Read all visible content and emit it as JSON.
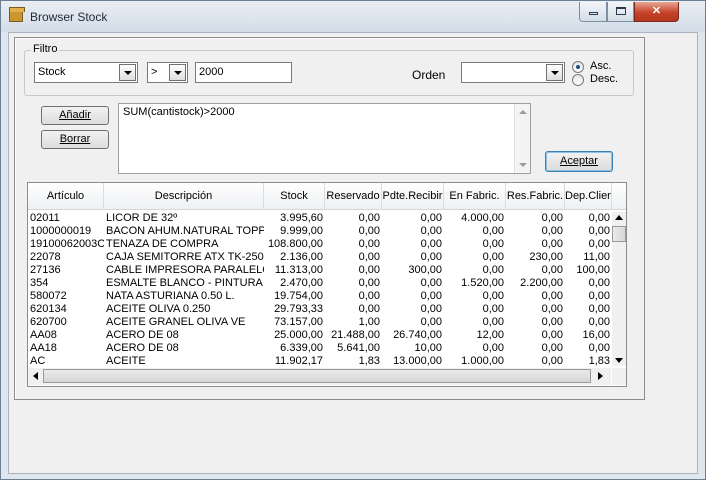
{
  "window": {
    "title": "Browser Stock"
  },
  "filter": {
    "group_label": "Filtro",
    "field_value": "Stock",
    "operator_value": ">",
    "value": "2000",
    "orden_label": "Orden",
    "orden_value": "",
    "asc_label": "Asc.",
    "desc_label": "Desc.",
    "selected_order": "Asc."
  },
  "buttons": {
    "add": "Añadir",
    "delete": "Borrar",
    "accept": "Aceptar"
  },
  "expression": "SUM(cantistock)>2000",
  "table": {
    "columns": [
      "Artículo",
      "Descripción",
      "Stock",
      "Reservado",
      "Pdte.Recibir",
      "En Fabric.",
      "Res.Fabric.",
      "Dep.Clientes"
    ],
    "rows": [
      [
        "02011",
        "LICOR DE 32º",
        "3.995,60",
        "0,00",
        "0,00",
        "4.000,00",
        "0,00",
        "0,00"
      ],
      [
        "1000000019",
        "BACON AHUM.NATURAL TOPP",
        "9.999,00",
        "0,00",
        "0,00",
        "0,00",
        "0,00",
        "0,00"
      ],
      [
        "19100062003C",
        "TENAZA DE COMPRA",
        "108.800,00",
        "0,00",
        "0,00",
        "0,00",
        "0,00",
        "0,00"
      ],
      [
        "22078",
        "CAJA SEMITORRE ATX TK-250",
        "2.136,00",
        "0,00",
        "0,00",
        "0,00",
        "230,00",
        "11,00"
      ],
      [
        "27136",
        "CABLE IMPRESORA PARALELO",
        "11.313,00",
        "0,00",
        "300,00",
        "0,00",
        "0,00",
        "100,00"
      ],
      [
        "354",
        "ESMALTE BLANCO - PINTURA",
        "2.470,00",
        "0,00",
        "0,00",
        "1.520,00",
        "2.200,00",
        "0,00"
      ],
      [
        "580072",
        "NATA ASTURIANA 0.50 L.",
        "19.754,00",
        "0,00",
        "0,00",
        "0,00",
        "0,00",
        "0,00"
      ],
      [
        "620134",
        "ACEITE OLIVA 0.250",
        "29.793,33",
        "0,00",
        "0,00",
        "0,00",
        "0,00",
        "0,00"
      ],
      [
        "620700",
        "ACEITE GRANEL OLIVA VE",
        "73.157,00",
        "1,00",
        "0,00",
        "0,00",
        "0,00",
        "0,00"
      ],
      [
        "AA08",
        "ACERO DE 08",
        "25.000,00",
        "21.488,00",
        "26.740,00",
        "12,00",
        "0,00",
        "16,00"
      ],
      [
        "AA18",
        "ACERO DE 08",
        "6.339,00",
        "5.641,00",
        "10,00",
        "0,00",
        "0,00",
        "0,00"
      ],
      [
        "AC",
        "ACEITE",
        "11.902,17",
        "1,83",
        "13.000,00",
        "1.000,00",
        "0,00",
        "1,83"
      ]
    ]
  },
  "icons": {
    "app": "box-icon",
    "minimize": "minimize-icon",
    "maximize": "maximize-icon",
    "close": "close-icon"
  },
  "colors": {
    "title_bar": "#dfe6ee",
    "close_button": "#c7432a",
    "accept_border": "#3c7fb1",
    "radio_selected": "#1d4f91"
  }
}
